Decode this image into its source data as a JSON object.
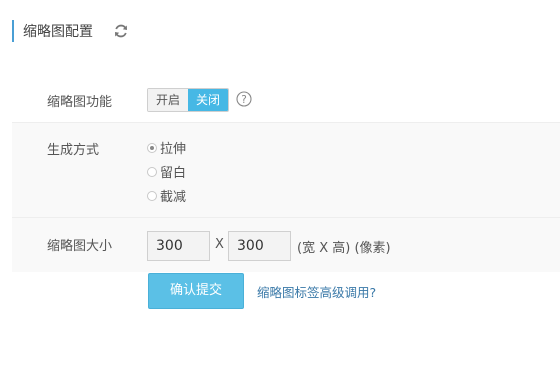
{
  "header": {
    "title": "缩略图配置",
    "refresh_icon": "refresh-icon"
  },
  "thumbnail_feature": {
    "label": "缩略图功能",
    "options": [
      "开启",
      "关闭"
    ],
    "selected": "关闭",
    "help_icon": "help-icon"
  },
  "generate_mode": {
    "label": "生成方式",
    "options": [
      "拉伸",
      "留白",
      "截减"
    ],
    "selected": "拉伸"
  },
  "size": {
    "label": "缩略图大小",
    "width": "300",
    "height": "300",
    "separator": "X",
    "unit_text": "(宽 X 高) (像素)"
  },
  "actions": {
    "submit_label": "确认提交",
    "advanced_link": "缩略图标签高级调用?"
  },
  "colors": {
    "accent": "#46b8e5",
    "header_bar": "#4a9fd5",
    "link": "#3a79a8"
  }
}
